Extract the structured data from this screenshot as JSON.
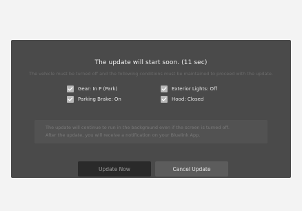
{
  "dialog": {
    "title": "The update will start soon. (11 sec)",
    "subtitle": "The vehicle must be turned off and the following conditions must be maintained to proceed with the update.",
    "conditions": [
      {
        "label": "Gear: In P (Park)",
        "checked": true
      },
      {
        "label": "Exterior Lights: Off",
        "checked": true
      },
      {
        "label": "Parking Brake: On",
        "checked": true
      },
      {
        "label": "Hood: Closed",
        "checked": true
      }
    ],
    "notice_line1": "The update will continue to run in the background even if the screen is turned off.",
    "notice_line2": "After the update, you will receive a notification on your Bluelink App.",
    "update_now_label": "Update Now",
    "cancel_update_label": "Cancel Update"
  },
  "colors": {
    "page_background": "#f3f3f3",
    "panel_background": "#4a4a4a",
    "checkbox_fill": "#b8b8b8",
    "update_button": "#2a2a2a",
    "cancel_button": "#5c5c5c"
  },
  "icons": {
    "checkbox": "checkmark-icon"
  }
}
